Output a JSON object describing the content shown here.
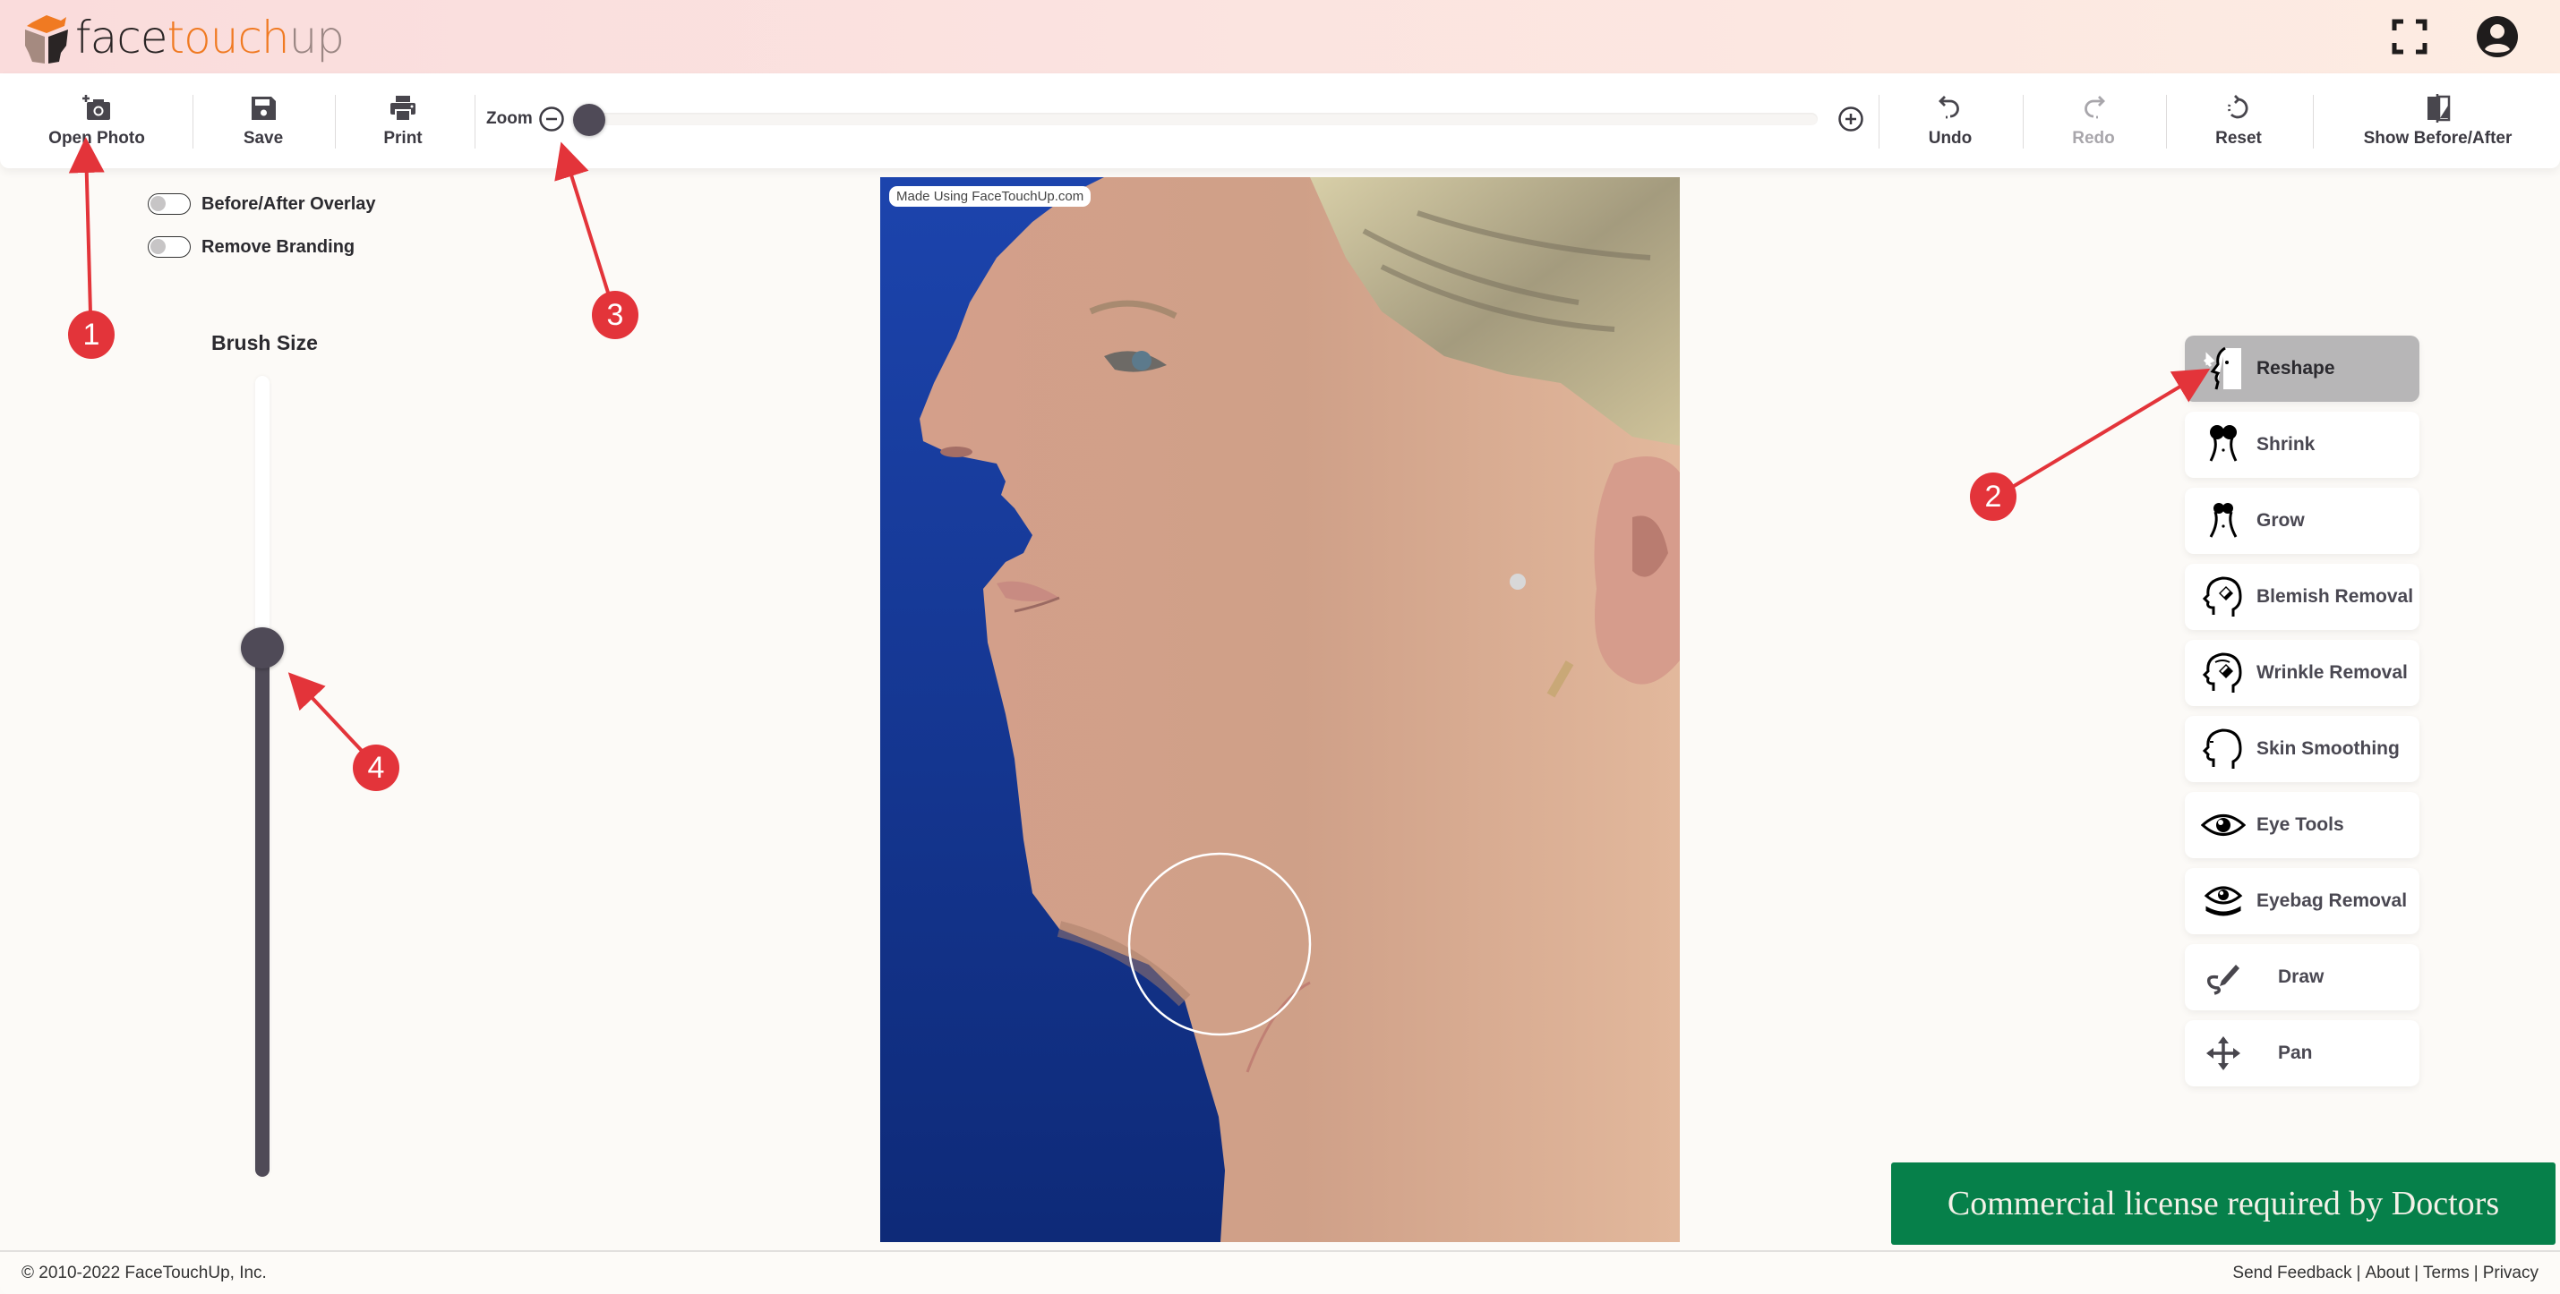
{
  "app": {
    "brand": {
      "part1": "face",
      "part2": "touch",
      "part3": "up"
    },
    "brand_colors": {
      "accent": "#f07a22",
      "dark": "#2a2525",
      "muted": "#9b8784"
    }
  },
  "header": {
    "icons": {
      "fullscreen": "fullscreen-icon",
      "account": "account-circle-icon"
    }
  },
  "toolbar": {
    "open_photo": "Open Photo",
    "save": "Save",
    "print": "Print",
    "zoom_label": "Zoom",
    "zoom_value_percent": 0,
    "undo": "Undo",
    "redo": "Redo",
    "redo_disabled": true,
    "reset": "Reset",
    "show_before_after": "Show Before/After"
  },
  "left_panel": {
    "toggles": [
      {
        "label": "Before/After Overlay",
        "on": false
      },
      {
        "label": "Remove Branding",
        "on": false
      }
    ],
    "brush_size_label": "Brush Size",
    "brush_size_fraction": 0.66
  },
  "canvas": {
    "watermark": "Made Using FaceTouchUp.com",
    "background_color": "#1a3fa3"
  },
  "tools": [
    {
      "label": "Reshape",
      "icon": "reshape-face-icon",
      "active": true
    },
    {
      "label": "Shrink",
      "icon": "shrink-icon",
      "active": false
    },
    {
      "label": "Grow",
      "icon": "grow-icon",
      "active": false
    },
    {
      "label": "Blemish Removal",
      "icon": "blemish-removal-icon",
      "active": false
    },
    {
      "label": "Wrinkle Removal",
      "icon": "wrinkle-removal-icon",
      "active": false
    },
    {
      "label": "Skin Smoothing",
      "icon": "skin-smoothing-icon",
      "active": false
    },
    {
      "label": "Eye Tools",
      "icon": "eye-icon",
      "active": false
    },
    {
      "label": "Eyebag Removal",
      "icon": "eyebag-icon",
      "active": false
    },
    {
      "label": "Draw",
      "icon": "draw-icon",
      "active": false
    },
    {
      "label": "Pan",
      "icon": "pan-move-icon",
      "active": false
    }
  ],
  "license_banner": {
    "text": "Commercial license required by Doctors",
    "color": "#06804a"
  },
  "footer": {
    "copyright": "© 2010-2022 FaceTouchUp, Inc.",
    "links": [
      "Send Feedback",
      "About",
      "Terms",
      "Privacy"
    ]
  },
  "annotations": {
    "color": "#e3343a",
    "markers": [
      "1",
      "2",
      "3",
      "4"
    ]
  }
}
